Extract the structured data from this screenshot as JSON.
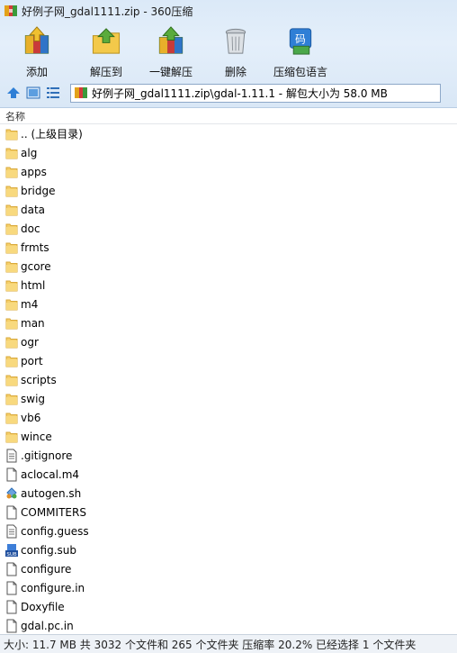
{
  "window": {
    "title": "好例子网_gdal1111.zip - 360压缩"
  },
  "toolbar": {
    "items": [
      {
        "label": "添加",
        "icon": "add-archive-icon"
      },
      {
        "label": "解压到",
        "icon": "extract-to-icon"
      },
      {
        "label": "一键解压",
        "icon": "one-click-extract-icon"
      },
      {
        "label": "删除",
        "icon": "delete-trash-icon"
      },
      {
        "label": "压缩包语言",
        "icon": "archive-language-icon"
      }
    ]
  },
  "address": {
    "path": "好例子网_gdal1111.zip\\gdal-1.11.1 - 解包大小为 58.0 MB"
  },
  "list": {
    "header": "名称",
    "rows": [
      {
        "name": ".. (上级目录)",
        "type": "folder"
      },
      {
        "name": "alg",
        "type": "folder"
      },
      {
        "name": "apps",
        "type": "folder"
      },
      {
        "name": "bridge",
        "type": "folder"
      },
      {
        "name": "data",
        "type": "folder"
      },
      {
        "name": "doc",
        "type": "folder"
      },
      {
        "name": "frmts",
        "type": "folder"
      },
      {
        "name": "gcore",
        "type": "folder"
      },
      {
        "name": "html",
        "type": "folder"
      },
      {
        "name": "m4",
        "type": "folder"
      },
      {
        "name": "man",
        "type": "folder"
      },
      {
        "name": "ogr",
        "type": "folder"
      },
      {
        "name": "port",
        "type": "folder"
      },
      {
        "name": "scripts",
        "type": "folder"
      },
      {
        "name": "swig",
        "type": "folder"
      },
      {
        "name": "vb6",
        "type": "folder"
      },
      {
        "name": "wince",
        "type": "folder"
      },
      {
        "name": ".gitignore",
        "type": "text"
      },
      {
        "name": "aclocal.m4",
        "type": "file"
      },
      {
        "name": "autogen.sh",
        "type": "script"
      },
      {
        "name": "COMMITERS",
        "type": "file"
      },
      {
        "name": "config.guess",
        "type": "text"
      },
      {
        "name": "config.sub",
        "type": "sub"
      },
      {
        "name": "configure",
        "type": "file"
      },
      {
        "name": "configure.in",
        "type": "file"
      },
      {
        "name": "Doxyfile",
        "type": "file"
      },
      {
        "name": "gdal.pc.in",
        "type": "file"
      }
    ]
  },
  "status": {
    "text": "大小: 11.7 MB 共 3032 个文件和 265 个文件夹 压缩率 20.2% 已经选择 1 个文件夹"
  }
}
